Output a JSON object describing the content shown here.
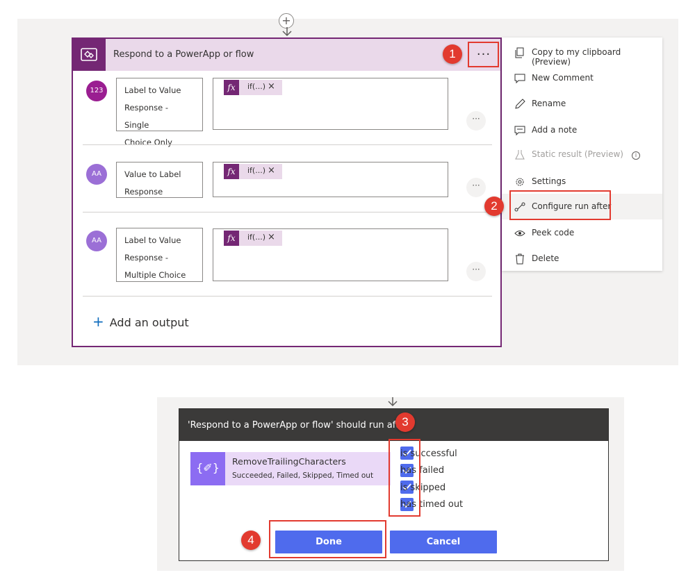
{
  "connector": {
    "plus": "+"
  },
  "card": {
    "title": "Respond to a PowerApp or flow",
    "more": "···",
    "outputs": [
      {
        "type_icon": "123",
        "label_lines": [
          "Label to Value",
          "Response - Single",
          "Choice Only"
        ],
        "token": "if(...)",
        "token_remove": "×",
        "more": "···"
      },
      {
        "type_icon": "AA",
        "label_lines": [
          "Value to Label",
          "Response"
        ],
        "token": "if(...)",
        "token_remove": "×",
        "more": "···"
      },
      {
        "type_icon": "AA",
        "label_lines": [
          "Label to Value",
          "Response -",
          "Multiple Choice"
        ],
        "token": "if(...)",
        "token_remove": "×",
        "more": "···"
      }
    ],
    "add_output": "Add an output",
    "fx_symbol": "fx"
  },
  "menu": {
    "items": [
      {
        "label": "Copy to my clipboard (Preview)",
        "icon": "copy-icon"
      },
      {
        "label": "New Comment",
        "icon": "comment-icon"
      },
      {
        "label": "Rename",
        "icon": "pencil-icon"
      },
      {
        "label": "Add a note",
        "icon": "note-icon"
      },
      {
        "label": "Static result (Preview)",
        "icon": "flask-icon",
        "disabled": true
      },
      {
        "label": "Settings",
        "icon": "gear-icon"
      },
      {
        "label": "Configure run after",
        "icon": "run-after-icon"
      },
      {
        "label": "Peek code",
        "icon": "eye-icon"
      },
      {
        "label": "Delete",
        "icon": "trash-icon"
      }
    ],
    "info": "i"
  },
  "dialog": {
    "title": "'Respond to a PowerApp or flow' should run after",
    "dependency": {
      "icon": "{✐}",
      "name": "RemoveTrailingCharacters",
      "status": "Succeeded, Failed, Skipped, Timed out"
    },
    "options": [
      {
        "label": "is successful",
        "checked": true
      },
      {
        "label": "has failed",
        "checked": true
      },
      {
        "label": "is skipped",
        "checked": true
      },
      {
        "label": "has timed out",
        "checked": true
      }
    ],
    "done_label": "Done",
    "cancel_label": "Cancel"
  },
  "callouts": [
    "1",
    "2",
    "3",
    "4"
  ],
  "colors": {
    "brand_purple": "#742774",
    "header_tint": "#ead9ea",
    "accent_blue": "#4f6bed",
    "callout_red": "#e23a2f"
  }
}
